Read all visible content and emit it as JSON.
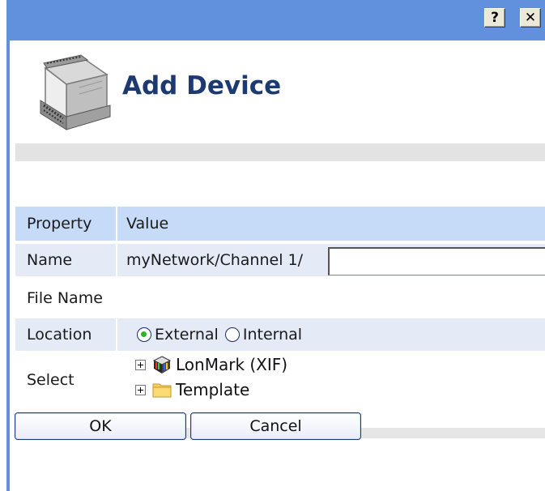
{
  "titlebar": {
    "help_label": "?",
    "close_label": "✕",
    "color": "#6191dc"
  },
  "header": {
    "title": "Add Device",
    "icon": "device-module-icon"
  },
  "table": {
    "header": {
      "property": "Property",
      "value": "Value"
    },
    "rows": {
      "name": {
        "label": "Name",
        "prefix": "myNetwork/Channel 1/",
        "input_value": ""
      },
      "file": {
        "label": "File Name",
        "value": ""
      },
      "location": {
        "label": "Location",
        "options": [
          {
            "label": "External",
            "checked": true
          },
          {
            "label": "Internal",
            "checked": false
          }
        ]
      },
      "select": {
        "label": "Select",
        "tree": [
          {
            "label": "LonMark (XIF)",
            "icon": "lonmark-cube-icon"
          },
          {
            "label": "Template",
            "icon": "folder-icon"
          }
        ]
      }
    }
  },
  "buttons": {
    "ok": "OK",
    "cancel": "Cancel"
  }
}
